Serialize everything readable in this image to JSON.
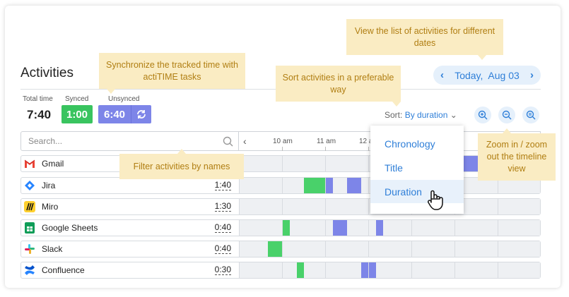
{
  "header": {
    "title": "Activities",
    "date_label": "Today,  Aug 03",
    "prev_icon": "chevron-left-icon",
    "next_icon": "chevron-right-icon"
  },
  "stats": {
    "total_label": "Total time",
    "total_value": "7:40",
    "synced_label": "Synced",
    "synced_value": "1:00",
    "unsynced_label": "Unsynced",
    "unsynced_value": "6:40",
    "sync_icon": "sync-icon"
  },
  "sort": {
    "prefix": "Sort:",
    "value": "By duration",
    "options": [
      "Chronology",
      "Title",
      "Duration"
    ],
    "selected": "Duration"
  },
  "search": {
    "placeholder": "Search..."
  },
  "timeline": {
    "ticks": [
      "10 am",
      "11 am",
      "12 a"
    ]
  },
  "activities": [
    {
      "name": "Gmail",
      "duration": ""
    },
    {
      "name": "Jira",
      "duration": "1:40"
    },
    {
      "name": "Miro",
      "duration": "1:30"
    },
    {
      "name": "Google Sheets",
      "duration": "0:40"
    },
    {
      "name": "Slack",
      "duration": "0:40"
    },
    {
      "name": "Confluence",
      "duration": "0:30"
    }
  ],
  "tooltips": {
    "sync": "Synchronize the tracked time with actiTIME tasks",
    "dates": "View the list of activities for different dates",
    "sort": "Sort activities in a preferable way",
    "filter": "Filter activities by names",
    "zoom": "Zoom in / zoom out the timeline view"
  },
  "colors": {
    "synced": "#39c45f",
    "unsynced": "#7d85e8",
    "accent": "#2f7fd8",
    "tooltip_bg": "#faecc3"
  }
}
